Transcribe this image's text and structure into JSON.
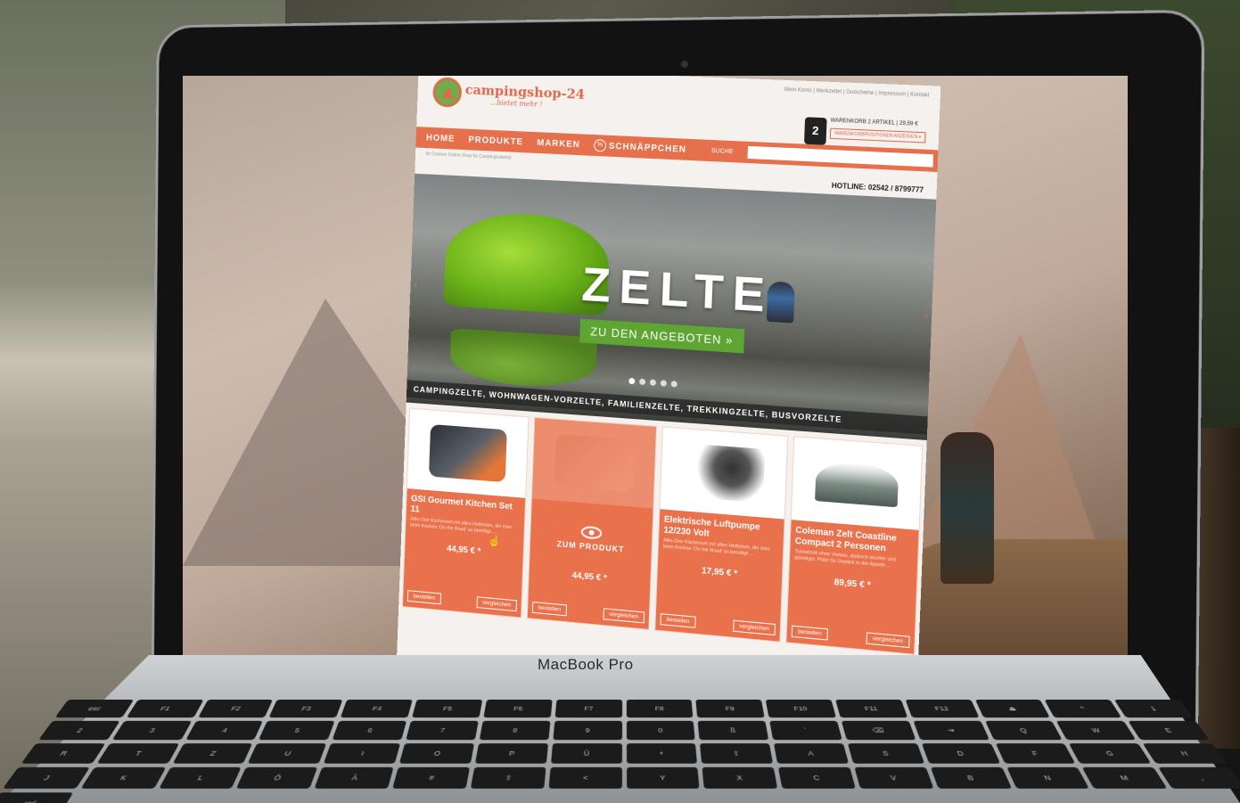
{
  "site": {
    "logo_name": "campingshop-24",
    "logo_sub": "...bietet mehr !",
    "top_links": "Mein Konto | Merkzettel | Gutscheine | Impressum | Kontakt",
    "cart": {
      "count": "2",
      "label": "WARENKORB 2 ARTIKEL | 29,59 €",
      "button": "WARENKORBPOSITIONEN ANZEIGEN ▾"
    },
    "nav": [
      "HOME",
      "PRODUKTE",
      "MARKEN"
    ],
    "nav_sale_badge": "%",
    "nav_sale": "SCHNÄPPCHEN",
    "search_label": "SUCHE",
    "search_placeholder": "",
    "search_go": "»",
    "tagline": "Ihr Outdoor Online-Shop für Campingzubehör",
    "hotline": "HOTLINE: 02542 / 8799777"
  },
  "hero": {
    "title": "ZELTE",
    "cta": "ZU DEN ANGEBOTEN »",
    "caption": "CAMPINGZELTE, WOHNWAGEN-VORZELTE, FAMILIENZELTE, TREKKINGZELTE, BUSVORZELTE",
    "arrow_left": "‹",
    "arrow_right": "›",
    "slide_count": 5,
    "active_slide": 0
  },
  "products": [
    {
      "title": "GSI Gourmet Kitchen Set 11",
      "desc": "Allin-One Küchenset mit allen Helferlein, die man beim Kochen 'On the Road' so benötigt ...",
      "price": "44,95 € *",
      "order": "bestellen",
      "compare": "vergleichen",
      "image": "kitchen-kit"
    },
    {
      "title": "",
      "desc": "",
      "price": "44,95 € *",
      "order": "bestellen",
      "compare": "vergleichen",
      "image": "kitchen-kit",
      "overlay": "ZUM PRODUKT"
    },
    {
      "title": "Elektrische Luftpumpe 12/230 Volt",
      "desc": "Allin-One Küchenset mit allen Helferlein, die man beim Kochen 'On the Road' so benötigt ...",
      "price": "17,95 € *",
      "order": "bestellen",
      "compare": "vergleichen",
      "image": "air-pump"
    },
    {
      "title": "Coleman Zelt Coastline Compact 2 Personen",
      "desc": "Tunnelzelt ohne Vorbau, dadurch leichter und günstiger. Platz für Gepäck in der Apside ...",
      "price": "89,95 € *",
      "order": "bestellen",
      "compare": "vergleichen",
      "image": "tent"
    }
  ],
  "laptop": {
    "brand": "MacBook Pro"
  },
  "keyboard": {
    "keys": [
      "esc",
      "F1",
      "F2",
      "F3",
      "F4",
      "F5",
      "F6",
      "F7",
      "F8",
      "F9",
      "F10",
      "F11",
      "F12",
      "⏏",
      "^",
      "1",
      "2",
      "3",
      "4",
      "5",
      "6",
      "7",
      "8",
      "9",
      "0",
      "ß",
      "´",
      "⌫",
      "⇥",
      "Q",
      "W",
      "E",
      "R",
      "T",
      "Z",
      "U",
      "I",
      "O",
      "P",
      "Ü",
      "+",
      "⇪",
      "A",
      "S",
      "D",
      "F",
      "G",
      "H",
      "J",
      "K",
      "L",
      "Ö",
      "Ä",
      "#",
      "⇧",
      "<",
      "Y",
      "X",
      "C",
      "V",
      "B",
      "N",
      "M",
      ",",
      "ctrl"
    ]
  }
}
